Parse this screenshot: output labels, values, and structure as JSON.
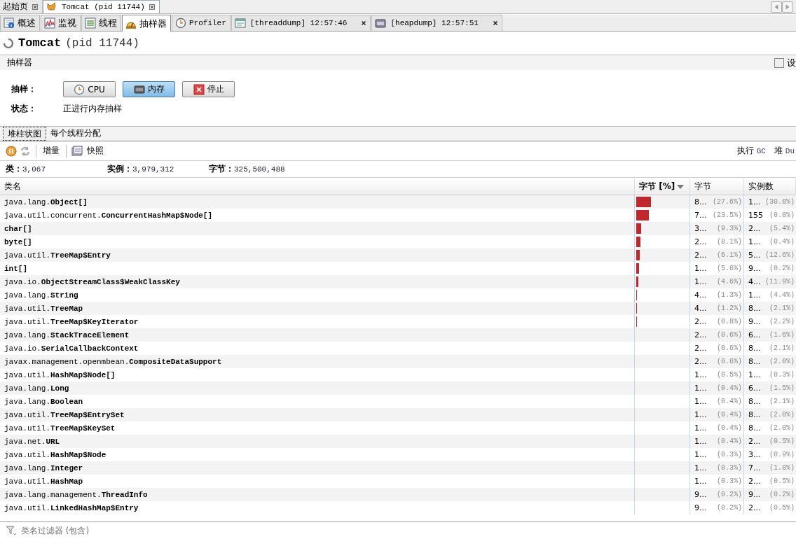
{
  "doc_tabs": [
    {
      "label": "起始页",
      "selected": false
    },
    {
      "label": "Tomcat (pid 11744)",
      "selected": true
    }
  ],
  "view_tabs": [
    {
      "label": "概述",
      "selected": false,
      "closable": false
    },
    {
      "label": "监视",
      "selected": false,
      "closable": false
    },
    {
      "label": "线程",
      "selected": false,
      "closable": false
    },
    {
      "label": "抽样器",
      "selected": true,
      "closable": false
    },
    {
      "label": "Profiler",
      "selected": false,
      "closable": false
    },
    {
      "label": "[threaddump] 12:57:46",
      "selected": false,
      "closable": true
    },
    {
      "label": "[heapdump] 12:57:51",
      "selected": false,
      "closable": true
    }
  ],
  "title": {
    "name": "Tomcat",
    "pid": "(pid 11744)"
  },
  "section": {
    "title": "抽样器",
    "checkbox": {
      "label": "设",
      "checked": false
    }
  },
  "sampling": {
    "label": "抽样：",
    "buttons": [
      {
        "label": "CPU",
        "selected": false
      },
      {
        "label": "内存",
        "selected": true
      },
      {
        "label": "停止",
        "selected": false
      }
    ],
    "status_label": "状态：",
    "status": "正进行内存抽样"
  },
  "result_tabs": [
    {
      "label": "堆柱状图",
      "selected": true
    },
    {
      "label": "每个线程分配",
      "selected": false
    }
  ],
  "toolbar": {
    "items": [
      "增量",
      "快照"
    ],
    "actions": [
      {
        "label": "执行",
        "code": "GC"
      },
      {
        "label": "堆",
        "code": "Du"
      }
    ]
  },
  "stats": [
    {
      "label": "类：",
      "value": "3,067"
    },
    {
      "label": "实例：",
      "value": "3,979,312"
    },
    {
      "label": "字节：",
      "value": "325,500,488"
    }
  ],
  "table": {
    "columns": [
      "类名",
      "字节 [%]",
      "字节",
      "实例数"
    ],
    "rows": [
      {
        "package": "java.lang.",
        "class": "Object[]",
        "level": 0.276,
        "bytes": "8...",
        "bytes_pct": "(27.6%)",
        "instances": "1...",
        "instances_pct": "(30.8%)"
      },
      {
        "package": "java.util.concurrent.",
        "class": "ConcurrentHashMap$Node[]",
        "level": 0.235,
        "bytes": "7...",
        "bytes_pct": "(23.5%)",
        "instances": "155",
        "instances_pct": "(0.0%)"
      },
      {
        "class": "char[]",
        "level": 0.093,
        "bytes": "3...",
        "bytes_pct": "(9.3%)",
        "instances": "2...",
        "instances_pct": "(5.4%)"
      },
      {
        "class": "byte[]",
        "level": 0.081,
        "bytes": "2...",
        "bytes_pct": "(8.1%)",
        "instances": "1...",
        "instances_pct": "(0.4%)"
      },
      {
        "package": "java.util.",
        "class": "TreeMap$Entry",
        "level": 0.061,
        "bytes": "2...",
        "bytes_pct": "(6.1%)",
        "instances": "5...",
        "instances_pct": "(12.6%)"
      },
      {
        "class": "int[]",
        "level": 0.056,
        "bytes": "1...",
        "bytes_pct": "(5.6%)",
        "instances": "9...",
        "instances_pct": "(0.2%)"
      },
      {
        "package": "java.io.",
        "class": "ObjectStreamClass$WeakClassKey",
        "level": 0.046,
        "bytes": "1...",
        "bytes_pct": "(4.6%)",
        "instances": "4...",
        "instances_pct": "(11.9%)"
      },
      {
        "package": "java.lang.",
        "class": "String",
        "level": 0.013,
        "bytes": "4...",
        "bytes_pct": "(1.3%)",
        "instances": "1...",
        "instances_pct": "(4.4%)"
      },
      {
        "package": "java.util.",
        "class": "TreeMap",
        "level": 0.012,
        "bytes": "4...",
        "bytes_pct": "(1.2%)",
        "instances": "8...",
        "instances_pct": "(2.1%)"
      },
      {
        "package": "java.util.",
        "class": "TreeMap$KeyIterator",
        "level": 0.008,
        "bytes": "2...",
        "bytes_pct": "(0.8%)",
        "instances": "9...",
        "instances_pct": "(2.2%)"
      },
      {
        "package": "java.lang.",
        "class": "StackTraceElement",
        "bytes": "2...",
        "bytes_pct": "(0.6%)",
        "instances": "6...",
        "instances_pct": "(1.6%)"
      },
      {
        "package": "java.io.",
        "class": "SerialCallbackContext",
        "bytes": "2...",
        "bytes_pct": "(0.6%)",
        "instances": "8...",
        "instances_pct": "(2.1%)"
      },
      {
        "package": "javax.management.openmbean.",
        "class": "CompositeDataSupport",
        "bytes": "2...",
        "bytes_pct": "(0.6%)",
        "instances": "8...",
        "instances_pct": "(2.0%)"
      },
      {
        "package": "java.util.",
        "class": "HashMap$Node[]",
        "bytes": "1...",
        "bytes_pct": "(0.5%)",
        "instances": "1...",
        "instances_pct": "(0.3%)"
      },
      {
        "package": "java.lang.",
        "class": "Long",
        "bytes": "1...",
        "bytes_pct": "(0.4%)",
        "instances": "6...",
        "instances_pct": "(1.5%)"
      },
      {
        "package": "java.lang.",
        "class": "Boolean",
        "bytes": "1...",
        "bytes_pct": "(0.4%)",
        "instances": "8...",
        "instances_pct": "(2.1%)"
      },
      {
        "package": "java.util.",
        "class": "TreeMap$EntrySet",
        "bytes": "1...",
        "bytes_pct": "(0.4%)",
        "instances": "8...",
        "instances_pct": "(2.0%)"
      },
      {
        "package": "java.util.",
        "class": "TreeMap$KeySet",
        "bytes": "1...",
        "bytes_pct": "(0.4%)",
        "instances": "8...",
        "instances_pct": "(2.0%)"
      },
      {
        "package": "java.net.",
        "class": "URL",
        "bytes": "1...",
        "bytes_pct": "(0.4%)",
        "instances": "2...",
        "instances_pct": "(0.5%)"
      },
      {
        "package": "java.util.",
        "class": "HashMap$Node",
        "bytes": "1...",
        "bytes_pct": "(0.3%)",
        "instances": "3...",
        "instances_pct": "(0.9%)"
      },
      {
        "package": "java.lang.",
        "class": "Integer",
        "bytes": "1...",
        "bytes_pct": "(0.3%)",
        "instances": "7...",
        "instances_pct": "(1.8%)"
      },
      {
        "package": "java.util.",
        "class": "HashMap",
        "bytes": "1...",
        "bytes_pct": "(0.3%)",
        "instances": "2...",
        "instances_pct": "(0.5%)"
      },
      {
        "package": "java.lang.management.",
        "class": "ThreadInfo",
        "bytes": "9...",
        "bytes_pct": "(0.2%)",
        "instances": "9...",
        "instances_pct": "(0.2%)"
      },
      {
        "package": "java.util.",
        "class": "LinkedHashMap$Entry",
        "bytes": "9...",
        "bytes_pct": "(0.2%)",
        "instances": "2...",
        "instances_pct": "(0.5%)"
      }
    ]
  },
  "filter": {
    "placeholder": "类名过滤器 (包含)"
  }
}
